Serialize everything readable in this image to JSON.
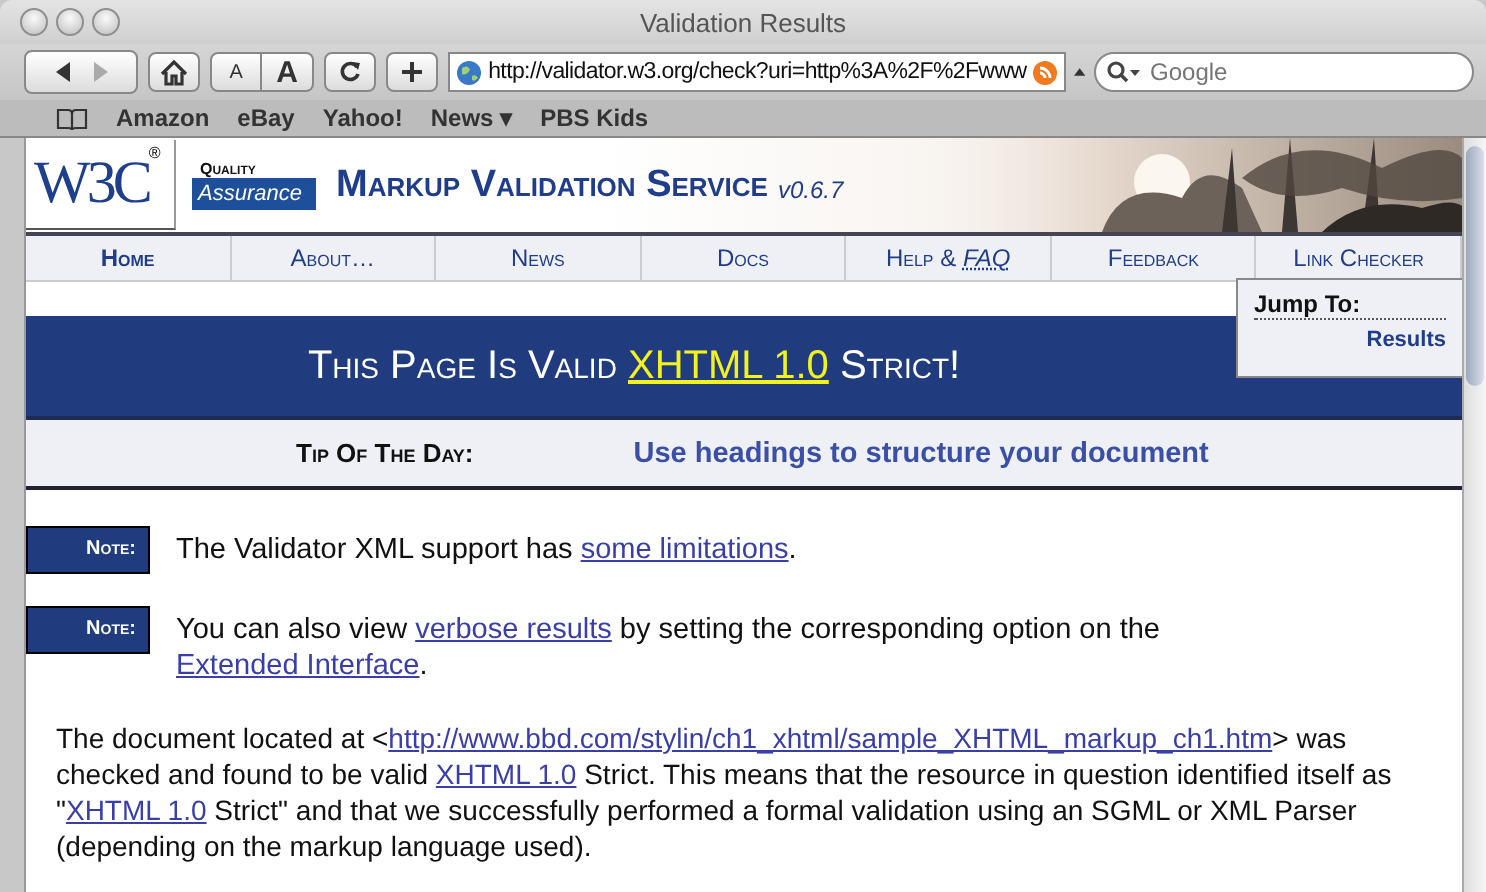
{
  "window": {
    "title": "Validation Results"
  },
  "toolbar": {
    "text_smaller": "A",
    "text_bigger": "A",
    "address": "http://validator.w3.org/check?uri=http%3A%2F%2Fwww",
    "search_placeholder": "Google"
  },
  "bookmarks": [
    "Amazon",
    "eBay",
    "Yahoo!",
    "News ▾",
    "PBS Kids"
  ],
  "banner": {
    "logo": "W3C",
    "logo_mark": "®",
    "qa_top": "Quality",
    "qa_bottom": "Assurance",
    "title": "Markup Validation Service",
    "version": "v0.6.7"
  },
  "nav": [
    {
      "label": "Home",
      "selected": true
    },
    {
      "label": "About…",
      "selected": false
    },
    {
      "label": "News",
      "selected": false
    },
    {
      "label": "Docs",
      "selected": false
    },
    {
      "label": "Help & ",
      "link_label": "FAQ",
      "selected": false
    },
    {
      "label": "Feedback",
      "selected": false
    },
    {
      "label": "Link Checker",
      "selected": false
    }
  ],
  "jump_to": {
    "title": "Jump To:",
    "links": [
      "Results"
    ]
  },
  "heading": [
    {
      "text": "This Page Is Valid "
    },
    {
      "text": "XHTML 1.0",
      "link": true
    },
    {
      "text": " Strict!"
    }
  ],
  "tip": {
    "label": "Tip Of The Day:",
    "text": "Use headings to structure your document"
  },
  "notes": [
    {
      "label": "Note:",
      "parts": [
        {
          "text": "The Validator XML support has "
        },
        {
          "text": "some limitations",
          "link": true
        },
        {
          "text": "."
        }
      ]
    },
    {
      "label": "Note:",
      "parts": [
        {
          "text": "You can also view "
        },
        {
          "text": "verbose results",
          "link": true
        },
        {
          "text": " by setting the corresponding option on the "
        },
        {
          "text": "Extended Interface",
          "link": true
        },
        {
          "text": "."
        }
      ]
    }
  ],
  "result": [
    {
      "text": "The document located at <"
    },
    {
      "text": "http://www.bbd.com/stylin/ch1_xhtml/sample_XHTML_markup_ch1.htm",
      "link": true
    },
    {
      "text": "> was checked and found to be valid "
    },
    {
      "text": "XHTML 1.0",
      "link": true
    },
    {
      "text": " Strict. This means that the resource in question identified itself as \""
    },
    {
      "text": "XHTML 1.0",
      "link": true
    },
    {
      "text": " Strict\" and that we successfully performed a formal validation using an SGML or XML Parser (depending on the markup language used)."
    }
  ]
}
